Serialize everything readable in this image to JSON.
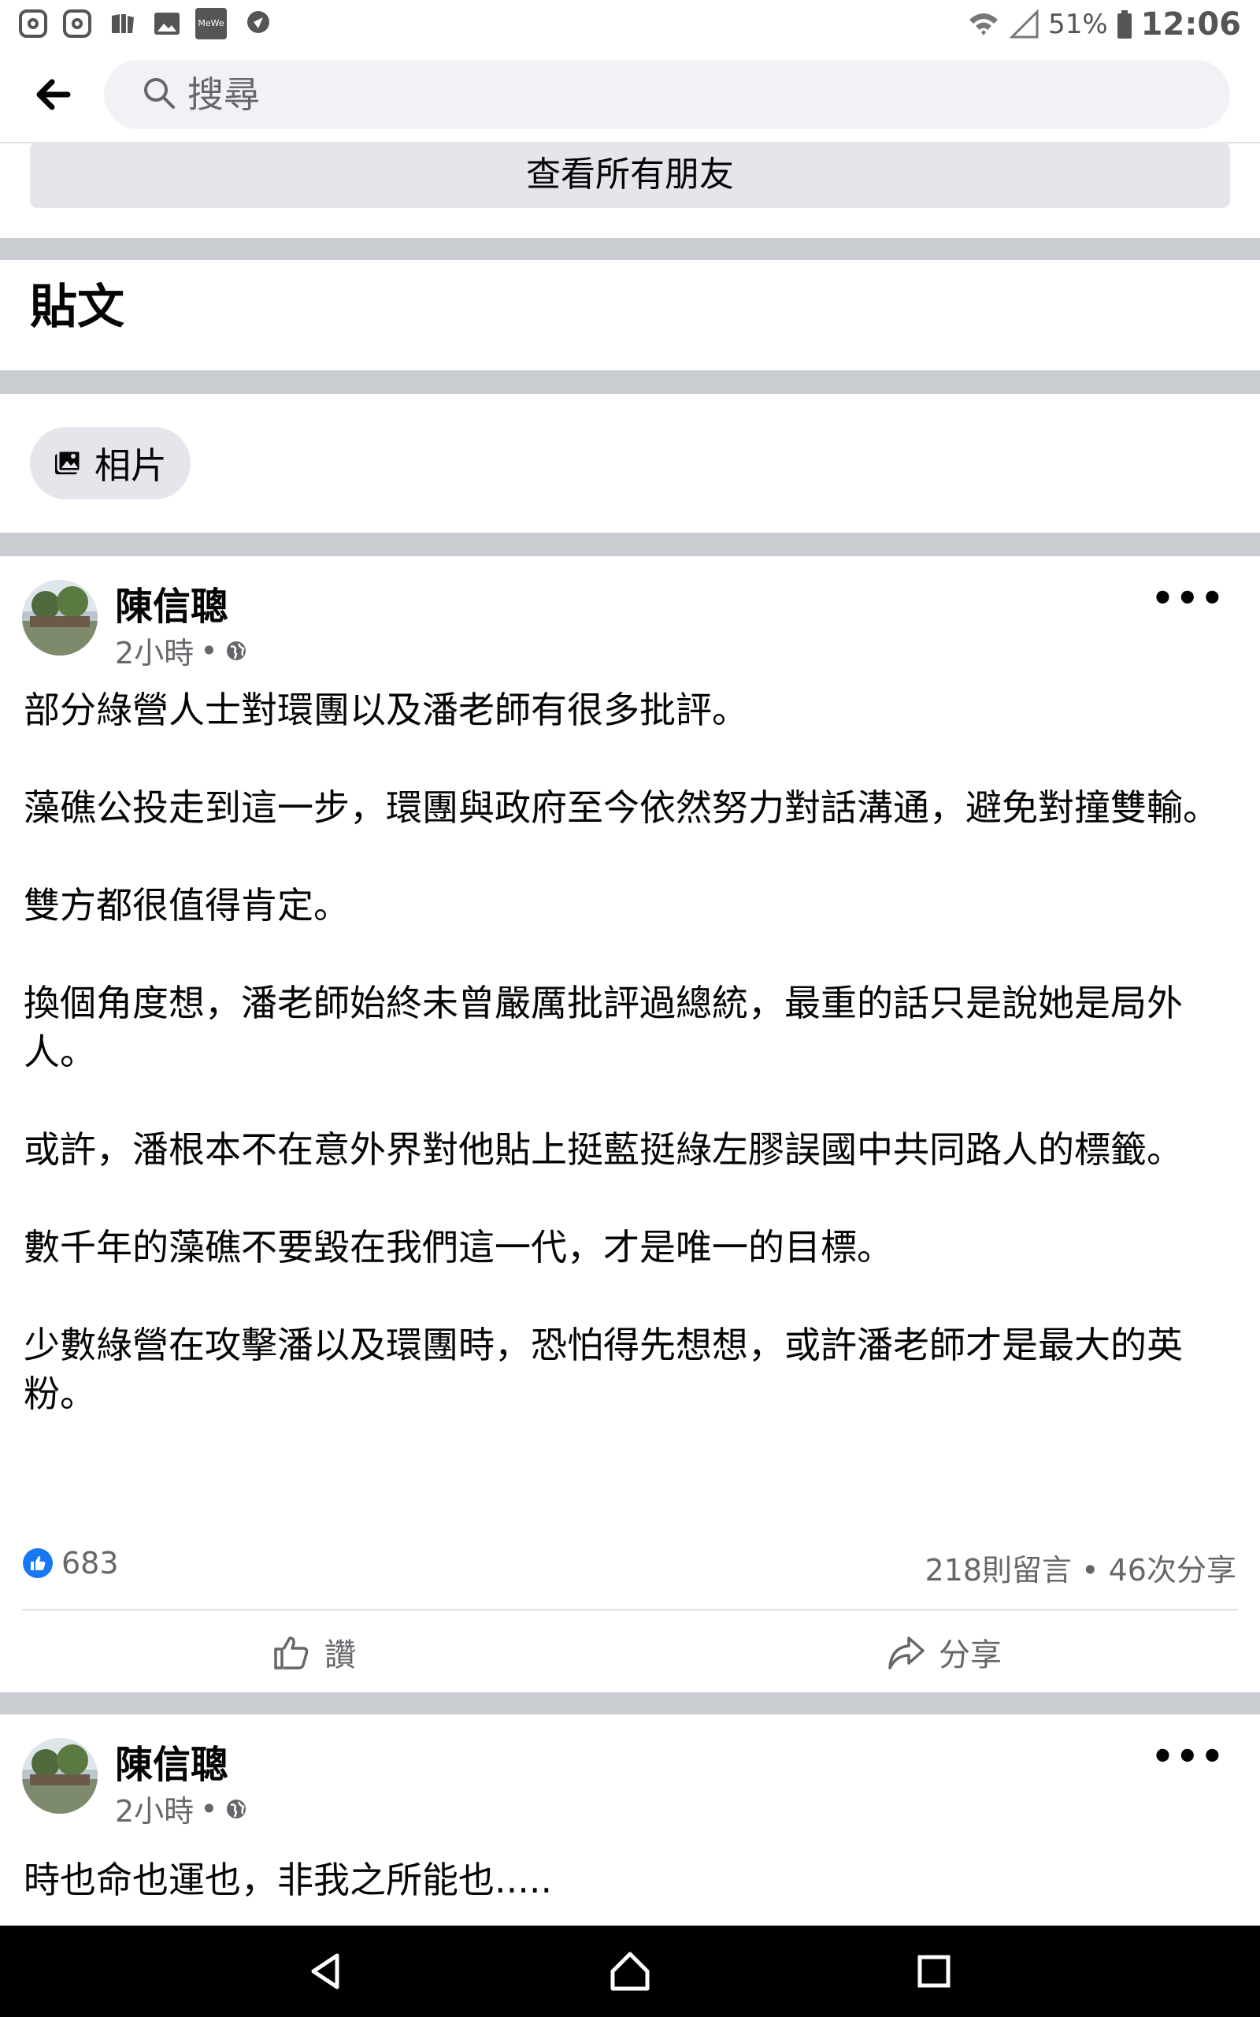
{
  "status_bar": {
    "left_icons": [
      "instagram-icon",
      "instagram-icon",
      "books-icon",
      "gallery-icon",
      "mewe-icon",
      "location-app-icon"
    ],
    "mewe_label": "MeWe",
    "battery": "51%",
    "time": "12:06"
  },
  "header": {
    "search_placeholder": "搜尋"
  },
  "friends": {
    "see_all_label": "查看所有朋友"
  },
  "posts_section": {
    "title": "貼文",
    "photos_chip": "相片"
  },
  "posts": [
    {
      "author": "陳信聰",
      "time": "2小時",
      "paragraphs": [
        "部分綠營人士對環團以及潘老師有很多批評。",
        "藻礁公投走到這一步，環團與政府至今依然努力對話溝通，避免對撞雙輸。",
        "雙方都很值得肯定。",
        "換個角度想，潘老師始終未曾嚴厲批評過總統，最重的話只是說她是局外人。",
        "或許，潘根本不在意外界對他貼上挺藍挺綠左膠誤國中共同路人的標籤。",
        "數千年的藻礁不要毀在我們這一代，才是唯一的目標。",
        "少數綠營在攻擊潘以及環團時，恐怕得先想想，或許潘老師才是最大的英粉。"
      ],
      "likes": "683",
      "comments_shares": "218則留言 • 46次分享",
      "like_label": "讚",
      "share_label": "分享"
    },
    {
      "author": "陳信聰",
      "time": "2小時",
      "text": "時也命也運也，非我之所能也....."
    }
  ],
  "colors": {
    "accent": "#1877f2",
    "secondary_text": "#65676b",
    "divider": "#c9ccd1",
    "button_bg": "#e4e6eb"
  }
}
